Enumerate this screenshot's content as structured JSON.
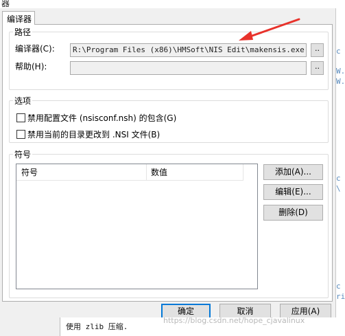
{
  "window": {
    "title_fragment": "器",
    "tab_label": "编译器"
  },
  "path_group": {
    "title": "路径",
    "compiler_label": "编译器(C):",
    "compiler_value": "R:\\Program Files (x86)\\HMSoft\\NIS Edit\\makensis.exe",
    "help_label": "帮助(H):",
    "help_value": "",
    "browse_label": ".."
  },
  "options_group": {
    "title": "选项",
    "opt1_label": "禁用配置文件 (nsisconf.nsh) 的包含(G)",
    "opt1_checked": false,
    "opt2_label": "禁用当前的目录更改到 .NSI 文件(B)",
    "opt2_checked": false
  },
  "symbols_group": {
    "title": "符号",
    "columns": [
      "符号",
      "数值"
    ],
    "rows": [],
    "add_button": "添加(A)...",
    "edit_button": "编辑(E)...",
    "delete_button": "删除(D)"
  },
  "footer": {
    "ok_button": "确定",
    "cancel_button": "取消",
    "apply_button": "应用(A)"
  },
  "background": {
    "bottom_text": "使用 zlib 压缩.",
    "watermark": "https://blog.csdn.net/hope_cjavalinux",
    "right_strip": [
      "c",
      "W.",
      "W.",
      "c",
      "\\",
      "c",
      "ri"
    ]
  },
  "colors": {
    "arrow": "#e8322b",
    "default_button_border": "#0078d7"
  }
}
